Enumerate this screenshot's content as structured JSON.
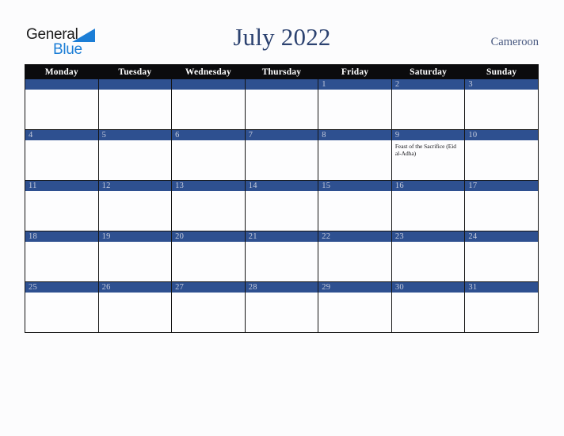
{
  "logo": {
    "word1": "General",
    "word2": "Blue",
    "triangle_color": "#1c7ed6",
    "word1_color": "#1b1b1b"
  },
  "header": {
    "title": "July 2022",
    "country": "Cameroon",
    "title_color": "#2c4270",
    "country_color": "#46577f"
  },
  "calendar": {
    "accent_color": "#2e5090",
    "header_bg": "#0b0b0d",
    "daynum_color": "#c5cbdc",
    "weekdays": [
      "Monday",
      "Tuesday",
      "Wednesday",
      "Thursday",
      "Friday",
      "Saturday",
      "Sunday"
    ],
    "weeks": [
      [
        {
          "day": ""
        },
        {
          "day": ""
        },
        {
          "day": ""
        },
        {
          "day": ""
        },
        {
          "day": "1"
        },
        {
          "day": "2"
        },
        {
          "day": "3"
        }
      ],
      [
        {
          "day": "4"
        },
        {
          "day": "5"
        },
        {
          "day": "6"
        },
        {
          "day": "7"
        },
        {
          "day": "8"
        },
        {
          "day": "9",
          "event": "Feast of the Sacrifice (Eid al-Adha)"
        },
        {
          "day": "10"
        }
      ],
      [
        {
          "day": "11"
        },
        {
          "day": "12"
        },
        {
          "day": "13"
        },
        {
          "day": "14"
        },
        {
          "day": "15"
        },
        {
          "day": "16"
        },
        {
          "day": "17"
        }
      ],
      [
        {
          "day": "18"
        },
        {
          "day": "19"
        },
        {
          "day": "20"
        },
        {
          "day": "21"
        },
        {
          "day": "22"
        },
        {
          "day": "23"
        },
        {
          "day": "24"
        }
      ],
      [
        {
          "day": "25"
        },
        {
          "day": "26"
        },
        {
          "day": "27"
        },
        {
          "day": "28"
        },
        {
          "day": "29"
        },
        {
          "day": "30"
        },
        {
          "day": "31"
        }
      ]
    ]
  }
}
